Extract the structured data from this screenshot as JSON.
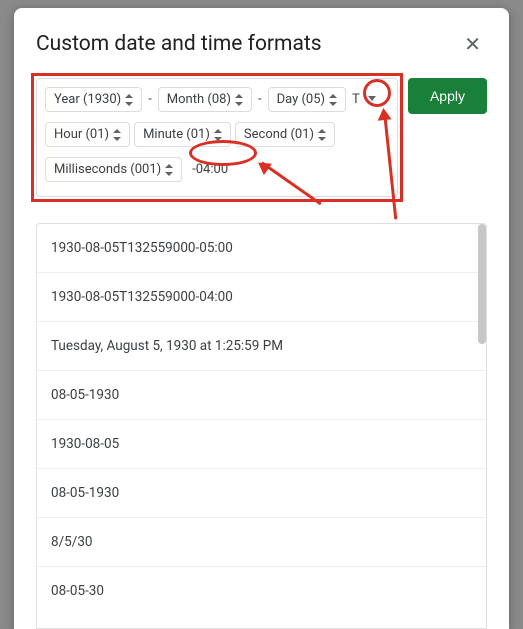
{
  "dialog": {
    "title": "Custom date and time formats",
    "apply_label": "Apply"
  },
  "format": {
    "chips": {
      "year": "Year (1930)",
      "month": "Month (08)",
      "day": "Day (05)",
      "hour": "Hour (01)",
      "minute": "Minute (01)",
      "second": "Second (01)",
      "ms": "Milliseconds (001)"
    },
    "separators": {
      "dash": "-",
      "literal_T": "T",
      "literal_tz": "-04:00"
    }
  },
  "options": [
    "1930-08-05T132559000-05:00",
    "1930-08-05T132559000-04:00",
    "Tuesday, August 5, 1930 at 1:25:59 PM",
    "08-05-1930",
    "1930-08-05",
    "08-05-1930",
    "8/5/30",
    "08-05-30"
  ]
}
